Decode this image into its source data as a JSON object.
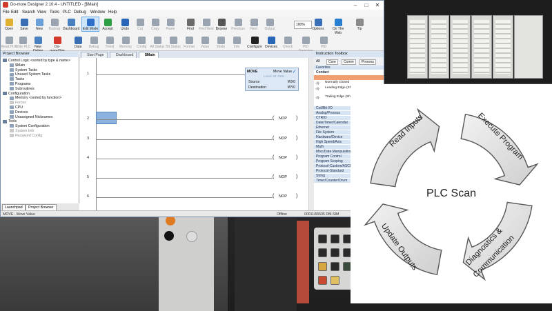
{
  "window": {
    "title": "Do-more Designer 2.10.4 - UNTITLED - [$Main]",
    "controls": {
      "minimize": "–",
      "maximize": "□",
      "close": "✕"
    }
  },
  "menu": [
    "File",
    "Edit",
    "Search",
    "View",
    "Tools",
    "PLC",
    "Debug",
    "Window",
    "Help"
  ],
  "toolbar1": [
    {
      "label": "Open",
      "icon": "folder-icon",
      "color": "#e0b030"
    },
    {
      "label": "Save",
      "icon": "save-icon",
      "color": "#3b6fb5"
    },
    {
      "label": "New",
      "icon": "new-icon",
      "color": "#6a9fd8"
    },
    {
      "label": "Backup",
      "icon": "backup-icon",
      "color": "#9aa4b0",
      "disabled": true
    },
    {
      "label": "Dashboard",
      "icon": "dashboard-icon",
      "color": "#4a7fc0"
    },
    {
      "label": "Edit Mode",
      "icon": "edit-mode-icon",
      "color": "#2f6ec9",
      "selected": true
    },
    {
      "label": "Accept",
      "icon": "accept-icon",
      "color": "#2f9e44"
    },
    {
      "label": "Undo",
      "icon": "undo-icon",
      "color": "#2a66b8"
    },
    {
      "label": "Cut",
      "icon": "cut-icon",
      "color": "#9aa4b0",
      "disabled": true
    },
    {
      "label": "Copy",
      "icon": "copy-icon",
      "color": "#9aa4b0",
      "disabled": true
    },
    {
      "label": "Paste",
      "icon": "paste-icon",
      "color": "#9aa4b0",
      "disabled": true
    },
    {
      "label": "Find",
      "icon": "find-icon",
      "color": "#6a6a6a"
    },
    {
      "label": "Find Next",
      "icon": "find-next-icon",
      "color": "#9aa4b0",
      "disabled": true
    },
    {
      "label": "Browse",
      "icon": "browse-icon",
      "color": "#555"
    },
    {
      "label": "Previous",
      "icon": "previous-icon",
      "color": "#9aa4b0",
      "disabled": true
    },
    {
      "label": "Next",
      "icon": "next-icon",
      "color": "#9aa4b0",
      "disabled": true
    },
    {
      "label": "Output",
      "icon": "output-icon",
      "color": "#9aa4b0",
      "disabled": true
    },
    {
      "label": "Options",
      "icon": "options-icon",
      "color": "#3b6fb5"
    },
    {
      "label": "On The Web",
      "icon": "web-icon",
      "color": "#2a7fd0"
    },
    {
      "label": "Tip",
      "icon": "tip-icon",
      "color": "#8a8a8a"
    }
  ],
  "zoom": "100%",
  "toolbar2": [
    {
      "label": "Read PLC",
      "icon": "read-plc-icon",
      "color": "#9aa4b0",
      "disabled": true
    },
    {
      "label": "Write PLC",
      "icon": "write-plc-icon",
      "color": "#9aa4b0",
      "disabled": true
    },
    {
      "label": "New Online",
      "icon": "new-online-icon",
      "color": "#4a7fc0"
    },
    {
      "label": "Do-more/Sim",
      "icon": "sim-icon",
      "color": "#d4372c"
    },
    {
      "label": "Data",
      "icon": "data-icon",
      "color": "#3b6fb5"
    },
    {
      "label": "Debug",
      "icon": "debug-icon",
      "color": "#9aa4b0",
      "disabled": true
    },
    {
      "label": "Trend",
      "icon": "trend-icon",
      "color": "#9aa4b0",
      "disabled": true
    },
    {
      "label": "Memory",
      "icon": "memory-icon",
      "color": "#9aa4b0",
      "disabled": true
    },
    {
      "label": "Config",
      "icon": "config-icon",
      "color": "#9aa4b0",
      "disabled": true
    },
    {
      "label": "All Status",
      "icon": "all-status-icon",
      "color": "#9aa4b0",
      "disabled": true
    },
    {
      "label": "Bit Status",
      "icon": "bit-status-icon",
      "color": "#9aa4b0",
      "disabled": true
    },
    {
      "label": "Format",
      "icon": "format-icon",
      "color": "#9aa4b0",
      "disabled": true
    },
    {
      "label": "Value",
      "icon": "value-icon",
      "color": "#9aa4b0",
      "disabled": true
    },
    {
      "label": "Mode",
      "icon": "mode-icon",
      "color": "#9aa4b0",
      "disabled": true
    },
    {
      "label": "Info",
      "icon": "info-icon",
      "color": "#9aa4b0",
      "disabled": true
    },
    {
      "label": "Configure",
      "icon": "configure-icon",
      "color": "#222"
    },
    {
      "label": "Devices",
      "icon": "devices-icon",
      "color": "#2a66b8"
    },
    {
      "label": "Check",
      "icon": "check-icon",
      "color": "#9aa4b0",
      "disabled": true
    },
    {
      "label": "PID Overview",
      "icon": "pid-icon",
      "color": "#9aa4b0",
      "disabled": true
    },
    {
      "label": "PID",
      "icon": "pid-view-icon",
      "color": "#9aa4b0",
      "disabled": true
    }
  ],
  "project_browser": {
    "title": "Project Browser",
    "items": [
      {
        "label": "Control Logic <sorted by type & name>",
        "indent": 0,
        "icon": "logic-icon"
      },
      {
        "label": "$Main",
        "indent": 1,
        "icon": "program-icon"
      },
      {
        "label": "System Tasks",
        "indent": 1,
        "icon": "task-icon"
      },
      {
        "label": "Unused System Tasks",
        "indent": 1,
        "icon": "task-icon"
      },
      {
        "label": "Tasks",
        "indent": 1,
        "icon": "task-icon"
      },
      {
        "label": "Programs",
        "indent": 1,
        "icon": "program-icon"
      },
      {
        "label": "Subroutines",
        "indent": 1,
        "icon": "subroutine-icon"
      },
      {
        "label": "Configuration",
        "indent": 0,
        "icon": "config-icon"
      },
      {
        "label": "Memory <sorted by function>",
        "indent": 1,
        "icon": "memory-icon"
      },
      {
        "label": "Forces",
        "indent": 1,
        "icon": "forces-icon",
        "dim": true
      },
      {
        "label": "CPU",
        "indent": 1,
        "icon": "cpu-icon"
      },
      {
        "label": "Devices",
        "indent": 1,
        "icon": "devices-icon"
      },
      {
        "label": "Unassigned Nicknames",
        "indent": 1,
        "icon": "nickname-icon"
      },
      {
        "label": "Tools",
        "indent": 0,
        "icon": "tools-icon"
      },
      {
        "label": "System Configuration",
        "indent": 1,
        "icon": "sysconfig-icon"
      },
      {
        "label": "System Info",
        "indent": 1,
        "icon": "info-icon",
        "dim": true
      },
      {
        "label": "Password Config",
        "indent": 1,
        "icon": "password-icon",
        "dim": true
      }
    ],
    "tabs": [
      "Launchpad",
      "Project Browser"
    ]
  },
  "doc_tabs": [
    "Start Page",
    "Dashboard",
    "$Main"
  ],
  "ladder": {
    "move": {
      "title": "MOVE",
      "subtitle": "Move Value",
      "note": "Local: 50 JOIN",
      "source_label": "Source",
      "source": "WX0",
      "dest_label": "Destination",
      "dest": "WY0"
    },
    "rungs": [
      {
        "num": "1",
        "nop": ""
      },
      {
        "num": "2",
        "nop": "NOP"
      },
      {
        "num": "3",
        "nop": "NOP"
      },
      {
        "num": "4",
        "nop": "NOP"
      },
      {
        "num": "5",
        "nop": "NOP"
      },
      {
        "num": "6",
        "nop": "NOP"
      }
    ]
  },
  "toolbox": {
    "title": "Instruction Toolbox",
    "filters": [
      "All",
      "Core",
      "Comm",
      "Process"
    ],
    "categories": [
      "Favorites",
      "Contact",
      "Coil/Bit I/O",
      "Analog/Process",
      "CTRIO",
      "Date/Timer/Calendar",
      "Ethernet",
      "File System",
      "Hardware/Device",
      "High Speed/Axis",
      "Math",
      "Misc/Date Manipulation",
      "Program Control",
      "Program Scoping",
      "Protocol-Custom/ASCII",
      "Protocol-Standard",
      "String",
      "Timer/Counter/Drum"
    ],
    "items": [
      "Normally Closed",
      "Leading Edge (Shift+F2)",
      "Trailing Edge (Shift+F3)"
    ]
  },
  "status": {
    "left": "MOVE - Move Value",
    "mid": "Offline",
    "right": "00011/65535 DM-SIM"
  },
  "plc_scan": {
    "center": "PLC Scan",
    "steps": [
      "Read Inputs",
      "Execute Program",
      "Diagnostics & Communication",
      "Update Outputs"
    ]
  }
}
